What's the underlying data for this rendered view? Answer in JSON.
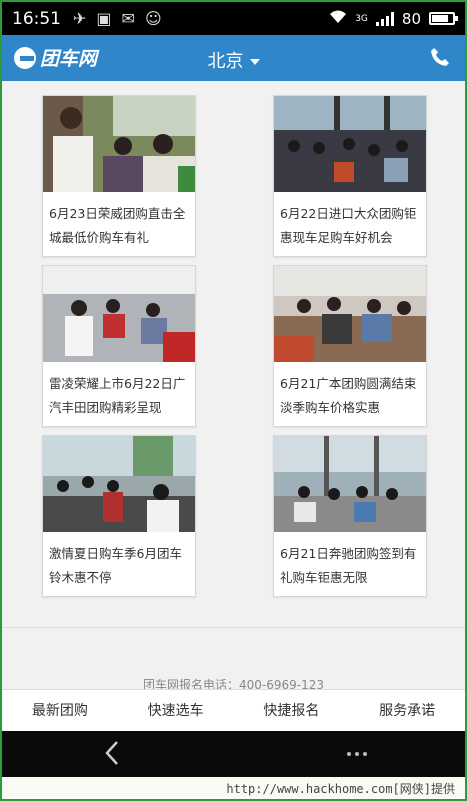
{
  "status_bar": {
    "time": "16:51",
    "network": "3G",
    "battery": "80",
    "battery_level": 0.8
  },
  "header": {
    "logo_text": "团车网",
    "city": "北京",
    "brand_color": "#2f86c9"
  },
  "articles": [
    {
      "title": "6月23日荣威团购直击全城最低价购车有礼",
      "image": "showroom-crowd-photo"
    },
    {
      "title": "6月22日进口大众团购钜惠现车足购车好机会",
      "image": "seated-audience-photo"
    },
    {
      "title": "雷凌荣耀上市6月22日广汽丰田团购精彩呈现",
      "image": "dealership-tables-photo"
    },
    {
      "title": "6月21广本团购圆满结束淡季购车价格实惠",
      "image": "meeting-room-photo"
    },
    {
      "title": "激情夏日购车季6月团车铃木惠不停",
      "image": "showroom-standing-photo"
    },
    {
      "title": "6月21日奔驰团购签到有礼购车钜惠无限",
      "image": "lobby-seated-photo"
    }
  ],
  "footer": {
    "hotline": "团车网报名电话：400-6969-123"
  },
  "tabs": [
    {
      "label": "最新团购"
    },
    {
      "label": "快速选车"
    },
    {
      "label": "快捷报名"
    },
    {
      "label": "服务承诺"
    }
  ],
  "watermark": "http://www.hackhome.com[网侠]提供"
}
